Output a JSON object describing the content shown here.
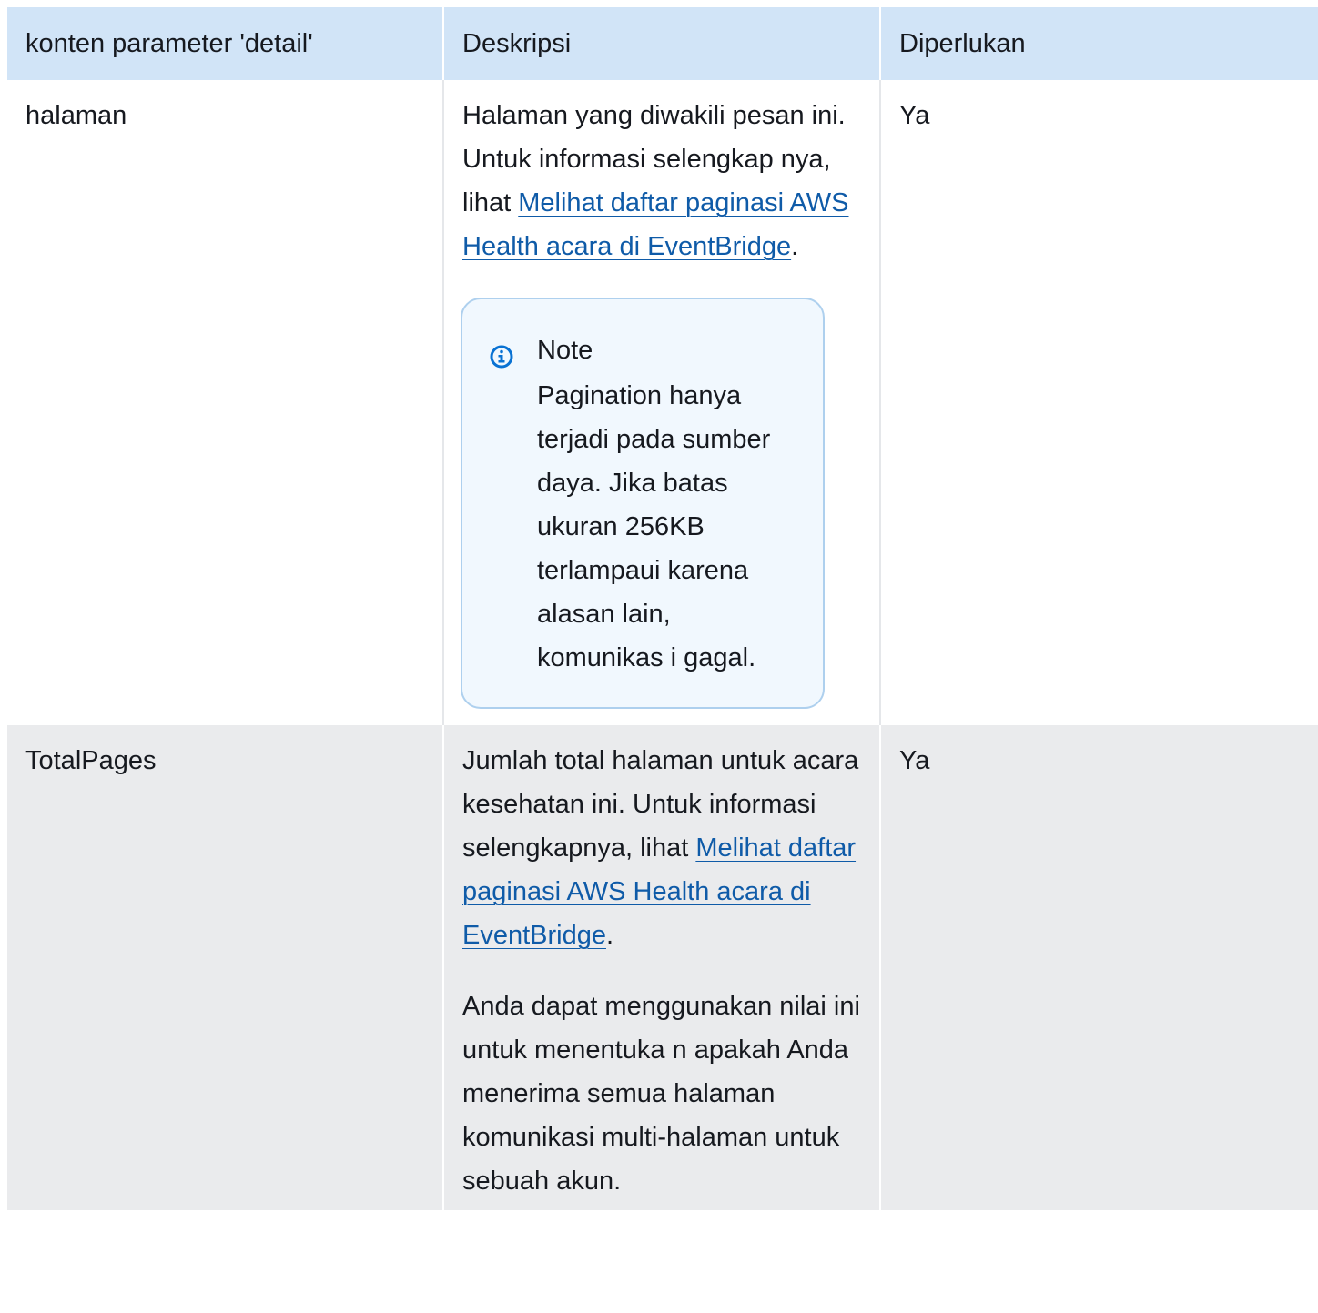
{
  "table": {
    "headers": [
      "konten parameter 'detail'",
      "Deskripsi",
      "Diperlukan"
    ],
    "rows": [
      {
        "param": "halaman",
        "desc": {
          "text_before": "Halaman yang diwakili pesan ini. Untuk informasi selengkap nya, lihat ",
          "link_text": "Melihat daftar paginasi AWS Health acara di EventBridge",
          "text_after": "."
        },
        "note": {
          "icon": "info-icon",
          "title": "Note",
          "body": "Pagination hanya terjadi pada sumber daya. Jika batas ukuran 256KB terlampaui karena alasan lain, komunikas i gagal."
        },
        "required": "Ya"
      },
      {
        "param": "TotalPages",
        "desc": {
          "text_before": "Jumlah total halaman untuk acara kesehatan ini. Untuk informasi selengkapnya, lihat ",
          "link_text": "Melihat daftar paginasi AWS Health acara di EventBridge",
          "text_after": ".",
          "extra_paragraph": "Anda dapat menggunakan nilai ini untuk menentuka n apakah Anda menerima semua halaman komunikasi multi-halaman untuk sebuah akun."
        },
        "required": "Ya"
      }
    ]
  },
  "colors": {
    "header_bg": "#d1e4f7",
    "alt_row_bg": "#eaebed",
    "link": "#0f5ba8",
    "note_border": "#aed0ee",
    "note_bg": "#f1f8fe",
    "info_icon": "#0972d3"
  }
}
